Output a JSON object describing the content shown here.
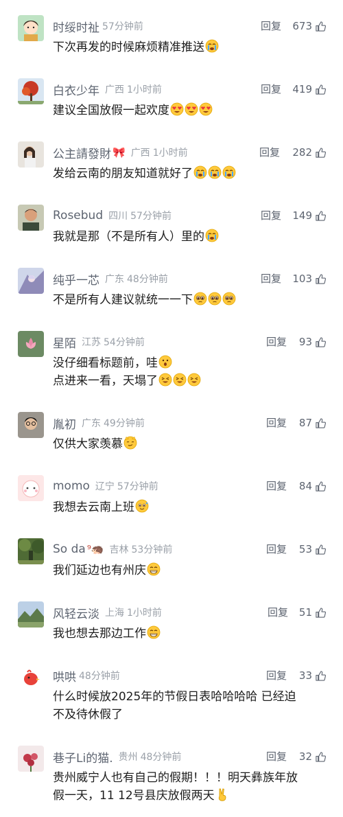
{
  "reply_label": "回复",
  "comments": [
    {
      "name": "时绥时祉",
      "badge": "",
      "location": "",
      "time": "57分钟前",
      "likes": "673",
      "lines": [
        "下次再发的时候麻烦精准推送"
      ],
      "emoji_icons": [
        [
          "crying-emoji-icon"
        ]
      ],
      "avatar": "cartoon-girl-avatar"
    },
    {
      "name": "白衣少年",
      "badge": "",
      "location": "广西",
      "time": "1小时前",
      "likes": "419",
      "lines": [
        "建议全国放假一起欢度"
      ],
      "emoji_icons": [
        [
          "heart-eyes-emoji-icon",
          "heart-eyes-emoji-icon",
          "heart-eyes-emoji-icon"
        ]
      ],
      "avatar": "red-tree-avatar"
    },
    {
      "name": "公主請發財",
      "badge": "🎀",
      "location": "广西",
      "time": "1小时前",
      "likes": "282",
      "lines": [
        "发给云南的朋友知道就好了"
      ],
      "emoji_icons": [
        [
          "crying-emoji-icon",
          "crying-emoji-icon",
          "crying-emoji-icon"
        ]
      ],
      "avatar": "girl-photo-avatar"
    },
    {
      "name": "Rosebud",
      "badge": "",
      "location": "四川",
      "time": "57分钟前",
      "likes": "149",
      "lines": [
        "我就是那（不是所有人）里的"
      ],
      "emoji_icons": [
        [
          "crying-emoji-icon"
        ]
      ],
      "avatar": "man-portrait-avatar"
    },
    {
      "name": "纯乎一芯",
      "badge": "",
      "location": "广东",
      "time": "48分钟前",
      "likes": "103",
      "lines": [
        "不是所有人建议就统一一下"
      ],
      "emoji_icons": [
        [
          "pleading-emoji-icon",
          "pleading-emoji-icon",
          "pleading-emoji-icon"
        ]
      ],
      "avatar": "anime-art-avatar"
    },
    {
      "name": "星陌",
      "badge": "",
      "location": "江苏",
      "time": "54分钟前",
      "likes": "93",
      "lines": [
        "没仔细看标题前，哇",
        "点进来一看，天塌了"
      ],
      "emoji_icons": [
        [
          "surprised-emoji-icon"
        ],
        [
          "tired-emoji-icon",
          "tired-emoji-icon",
          "tired-emoji-icon"
        ]
      ],
      "avatar": "lotus-avatar"
    },
    {
      "name": "胤初",
      "badge": "",
      "location": "广东",
      "time": "49分钟前",
      "likes": "87",
      "lines": [
        "仅供大家羡慕"
      ],
      "emoji_icons": [
        [
          "smirk-cat-emoji-icon"
        ]
      ],
      "avatar": "man-selfie-avatar"
    },
    {
      "name": "momo",
      "badge": "",
      "location": "辽宁",
      "time": "57分钟前",
      "likes": "84",
      "lines": [
        "我想去云南上班"
      ],
      "emoji_icons": [
        [
          "hopeful-emoji-icon"
        ]
      ],
      "avatar": "pink-character-avatar"
    },
    {
      "name": "So da",
      "badge": "⁹🦔",
      "location": "吉林",
      "time": "53分钟前",
      "likes": "53",
      "lines": [
        "我们延边也有州庆"
      ],
      "emoji_icons": [
        [
          "grin-emoji-icon"
        ]
      ],
      "avatar": "forest-avatar"
    },
    {
      "name": "风轻云淡",
      "badge": "",
      "location": "上海",
      "time": "1小时前",
      "likes": "51",
      "lines": [
        "我也想去那边工作"
      ],
      "emoji_icons": [
        [
          "grin-emoji-icon"
        ]
      ],
      "avatar": "landscape-avatar"
    },
    {
      "name": "哄哄",
      "badge": "",
      "location": "",
      "time": "48分钟前",
      "likes": "33",
      "lines": [
        "什么时候放2025年的节假日表哈哈哈哈 已经迫",
        "不及待休假了"
      ],
      "emoji_icons": [
        [],
        []
      ],
      "avatar": "red-bird-avatar"
    },
    {
      "name": "巷子Li的猫.",
      "badge": "",
      "location": "贵州",
      "time": "48分钟前",
      "likes": "32",
      "lines": [
        "贵州威宁人也有自己的假期！！！明天彝族年放",
        "假一天，11 12号县庆放假两天"
      ],
      "emoji_icons": [
        [],
        [
          "victory-hand-emoji-icon"
        ]
      ],
      "avatar": "flower-art-avatar"
    }
  ],
  "colors": {
    "name": "#5d6470",
    "meta": "#9aa0a8",
    "text": "#1d1d1d",
    "emoji_face": "#ffc93c"
  }
}
